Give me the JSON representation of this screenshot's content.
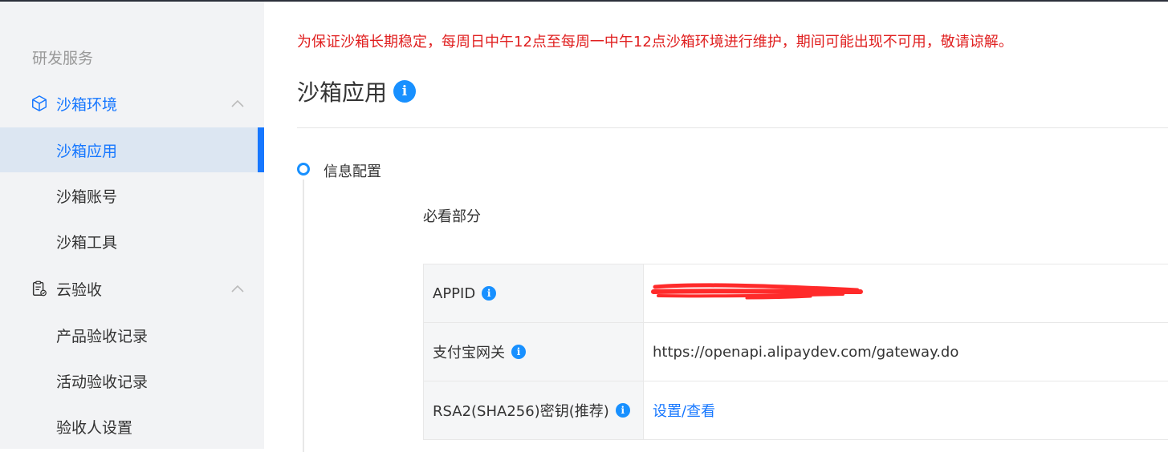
{
  "sidebar": {
    "section_title": "研发服务",
    "groups": [
      {
        "label": "沙箱环境",
        "icon": "cube-icon",
        "expanded": true,
        "items": [
          {
            "label": "沙箱应用",
            "active": true
          },
          {
            "label": "沙箱账号",
            "active": false
          },
          {
            "label": "沙箱工具",
            "active": false
          }
        ]
      },
      {
        "label": "云验收",
        "icon": "clipboard-check-icon",
        "expanded": true,
        "items": [
          {
            "label": "产品验收记录",
            "active": false
          },
          {
            "label": "活动验收记录",
            "active": false
          },
          {
            "label": "验收人设置",
            "active": false
          }
        ]
      }
    ]
  },
  "main": {
    "notice": "为保证沙箱长期稳定，每周日中午12点至每周一中午12点沙箱环境进行维护，期间可能出现不可用，敬请谅解。",
    "title": "沙箱应用",
    "step_label": "信息配置",
    "section_title": "必看部分",
    "rows": [
      {
        "label": "APPID",
        "value": "",
        "redacted": true
      },
      {
        "label": "支付宝网关",
        "value": "https://openapi.alipaydev.com/gateway.do"
      },
      {
        "label": "RSA2(SHA256)密钥(推荐)",
        "value": "设置/查看",
        "link": true
      }
    ]
  },
  "colors": {
    "accent": "#1677ff",
    "notice": "#e02020",
    "info_badge": "#1890ff",
    "redaction": "#ff2a2a"
  }
}
